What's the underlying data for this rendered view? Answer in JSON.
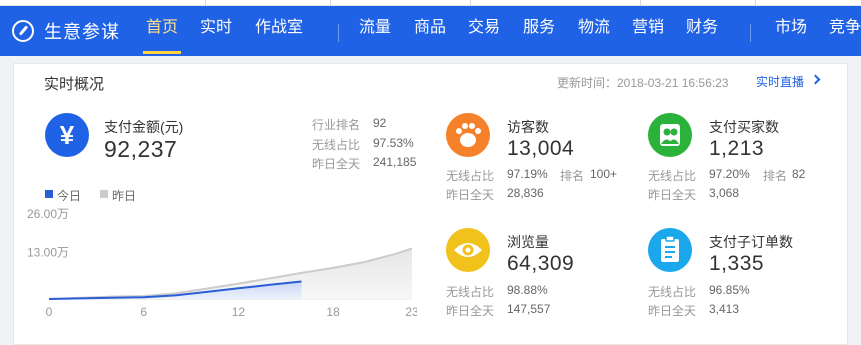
{
  "nav": {
    "logo_text": "生意参谋",
    "items": [
      "首页",
      "实时",
      "作战室",
      "流量",
      "商品",
      "交易",
      "服务",
      "物流",
      "营销",
      "财务",
      "市场",
      "竞争"
    ]
  },
  "overview": {
    "title": "实时概况",
    "update_time": "更新时间：2018-03-21 16:56:23",
    "live_link": "实时直播"
  },
  "payment": {
    "icon_glyph": "¥",
    "label": "支付金额(元)",
    "value": "92,237",
    "stats": [
      {
        "label": "行业排名",
        "value": "92"
      },
      {
        "label": "无线占比",
        "value": "97.53%"
      },
      {
        "label": "昨日全天",
        "value": "241,185"
      }
    ]
  },
  "chart_legend": {
    "today": "今日",
    "yesterday": "昨日"
  },
  "chart_data": {
    "type": "area",
    "x_ticks": [
      "0",
      "6",
      "12",
      "18",
      "23"
    ],
    "y_ticks": [
      "26.00万",
      "13.00万"
    ],
    "ylim": [
      0,
      26
    ],
    "series": [
      {
        "name": "今日",
        "x": [
          0,
          2,
          4,
          6,
          8,
          10,
          12,
          14,
          16
        ],
        "values": [
          0.0,
          0.2,
          0.4,
          0.6,
          1.2,
          2.4,
          3.6,
          4.8,
          5.9
        ]
      },
      {
        "name": "昨日",
        "x": [
          0,
          2,
          4,
          6,
          8,
          10,
          12,
          14,
          16,
          18,
          20,
          22,
          23
        ],
        "values": [
          0.0,
          0.4,
          0.8,
          1.0,
          1.9,
          3.5,
          5.2,
          7.0,
          8.8,
          10.5,
          12.5,
          15.3,
          17.1
        ]
      }
    ],
    "colors": {
      "today": "#2a5dd6",
      "yesterday": "#cccccc"
    }
  },
  "metrics": [
    {
      "key": "visitors",
      "label": "访客数",
      "value": "13,004",
      "color": "#f5822a",
      "icon": "footprint-icon",
      "stats": [
        {
          "label": "无线占比",
          "value": "97.19%"
        },
        {
          "label": "排名",
          "value": "100+"
        },
        {
          "label": "昨日全天",
          "value": "28,836"
        }
      ]
    },
    {
      "key": "buyers",
      "label": "支付买家数",
      "value": "1,213",
      "color": "#2ab23a",
      "icon": "buyers-icon",
      "stats": [
        {
          "label": "无线占比",
          "value": "97.20%"
        },
        {
          "label": "排名",
          "value": "82"
        },
        {
          "label": "昨日全天",
          "value": "3,068"
        }
      ]
    },
    {
      "key": "pageviews",
      "label": "浏览量",
      "value": "64,309",
      "color": "#f2c21c",
      "icon": "eye-icon",
      "stats": [
        {
          "label": "无线占比",
          "value": "98.88%"
        },
        {
          "label": "昨日全天",
          "value": "147,557"
        }
      ]
    },
    {
      "key": "suborders",
      "label": "支付子订单数",
      "value": "1,335",
      "color": "#1aa7ec",
      "icon": "clipboard-icon",
      "stats": [
        {
          "label": "无线占比",
          "value": "96.85%"
        },
        {
          "label": "昨日全天",
          "value": "3,413"
        }
      ]
    }
  ]
}
